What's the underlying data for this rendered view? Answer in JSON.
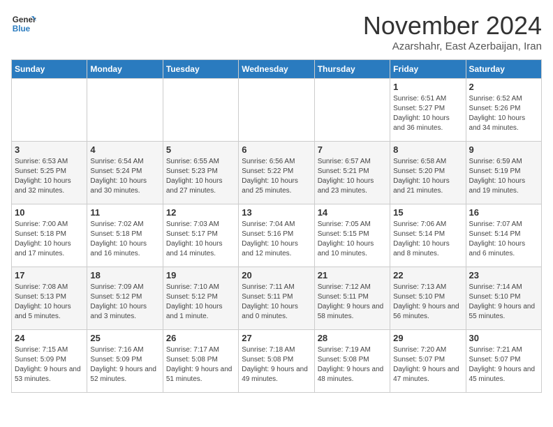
{
  "header": {
    "logo_line1": "General",
    "logo_line2": "Blue",
    "month_title": "November 2024",
    "subtitle": "Azarshahr, East Azerbaijan, Iran"
  },
  "weekdays": [
    "Sunday",
    "Monday",
    "Tuesday",
    "Wednesday",
    "Thursday",
    "Friday",
    "Saturday"
  ],
  "weeks": [
    [
      {
        "day": "",
        "info": ""
      },
      {
        "day": "",
        "info": ""
      },
      {
        "day": "",
        "info": ""
      },
      {
        "day": "",
        "info": ""
      },
      {
        "day": "",
        "info": ""
      },
      {
        "day": "1",
        "info": "Sunrise: 6:51 AM\nSunset: 5:27 PM\nDaylight: 10 hours and 36 minutes."
      },
      {
        "day": "2",
        "info": "Sunrise: 6:52 AM\nSunset: 5:26 PM\nDaylight: 10 hours and 34 minutes."
      }
    ],
    [
      {
        "day": "3",
        "info": "Sunrise: 6:53 AM\nSunset: 5:25 PM\nDaylight: 10 hours and 32 minutes."
      },
      {
        "day": "4",
        "info": "Sunrise: 6:54 AM\nSunset: 5:24 PM\nDaylight: 10 hours and 30 minutes."
      },
      {
        "day": "5",
        "info": "Sunrise: 6:55 AM\nSunset: 5:23 PM\nDaylight: 10 hours and 27 minutes."
      },
      {
        "day": "6",
        "info": "Sunrise: 6:56 AM\nSunset: 5:22 PM\nDaylight: 10 hours and 25 minutes."
      },
      {
        "day": "7",
        "info": "Sunrise: 6:57 AM\nSunset: 5:21 PM\nDaylight: 10 hours and 23 minutes."
      },
      {
        "day": "8",
        "info": "Sunrise: 6:58 AM\nSunset: 5:20 PM\nDaylight: 10 hours and 21 minutes."
      },
      {
        "day": "9",
        "info": "Sunrise: 6:59 AM\nSunset: 5:19 PM\nDaylight: 10 hours and 19 minutes."
      }
    ],
    [
      {
        "day": "10",
        "info": "Sunrise: 7:00 AM\nSunset: 5:18 PM\nDaylight: 10 hours and 17 minutes."
      },
      {
        "day": "11",
        "info": "Sunrise: 7:02 AM\nSunset: 5:18 PM\nDaylight: 10 hours and 16 minutes."
      },
      {
        "day": "12",
        "info": "Sunrise: 7:03 AM\nSunset: 5:17 PM\nDaylight: 10 hours and 14 minutes."
      },
      {
        "day": "13",
        "info": "Sunrise: 7:04 AM\nSunset: 5:16 PM\nDaylight: 10 hours and 12 minutes."
      },
      {
        "day": "14",
        "info": "Sunrise: 7:05 AM\nSunset: 5:15 PM\nDaylight: 10 hours and 10 minutes."
      },
      {
        "day": "15",
        "info": "Sunrise: 7:06 AM\nSunset: 5:14 PM\nDaylight: 10 hours and 8 minutes."
      },
      {
        "day": "16",
        "info": "Sunrise: 7:07 AM\nSunset: 5:14 PM\nDaylight: 10 hours and 6 minutes."
      }
    ],
    [
      {
        "day": "17",
        "info": "Sunrise: 7:08 AM\nSunset: 5:13 PM\nDaylight: 10 hours and 5 minutes."
      },
      {
        "day": "18",
        "info": "Sunrise: 7:09 AM\nSunset: 5:12 PM\nDaylight: 10 hours and 3 minutes."
      },
      {
        "day": "19",
        "info": "Sunrise: 7:10 AM\nSunset: 5:12 PM\nDaylight: 10 hours and 1 minute."
      },
      {
        "day": "20",
        "info": "Sunrise: 7:11 AM\nSunset: 5:11 PM\nDaylight: 10 hours and 0 minutes."
      },
      {
        "day": "21",
        "info": "Sunrise: 7:12 AM\nSunset: 5:11 PM\nDaylight: 9 hours and 58 minutes."
      },
      {
        "day": "22",
        "info": "Sunrise: 7:13 AM\nSunset: 5:10 PM\nDaylight: 9 hours and 56 minutes."
      },
      {
        "day": "23",
        "info": "Sunrise: 7:14 AM\nSunset: 5:10 PM\nDaylight: 9 hours and 55 minutes."
      }
    ],
    [
      {
        "day": "24",
        "info": "Sunrise: 7:15 AM\nSunset: 5:09 PM\nDaylight: 9 hours and 53 minutes."
      },
      {
        "day": "25",
        "info": "Sunrise: 7:16 AM\nSunset: 5:09 PM\nDaylight: 9 hours and 52 minutes."
      },
      {
        "day": "26",
        "info": "Sunrise: 7:17 AM\nSunset: 5:08 PM\nDaylight: 9 hours and 51 minutes."
      },
      {
        "day": "27",
        "info": "Sunrise: 7:18 AM\nSunset: 5:08 PM\nDaylight: 9 hours and 49 minutes."
      },
      {
        "day": "28",
        "info": "Sunrise: 7:19 AM\nSunset: 5:08 PM\nDaylight: 9 hours and 48 minutes."
      },
      {
        "day": "29",
        "info": "Sunrise: 7:20 AM\nSunset: 5:07 PM\nDaylight: 9 hours and 47 minutes."
      },
      {
        "day": "30",
        "info": "Sunrise: 7:21 AM\nSunset: 5:07 PM\nDaylight: 9 hours and 45 minutes."
      }
    ]
  ]
}
